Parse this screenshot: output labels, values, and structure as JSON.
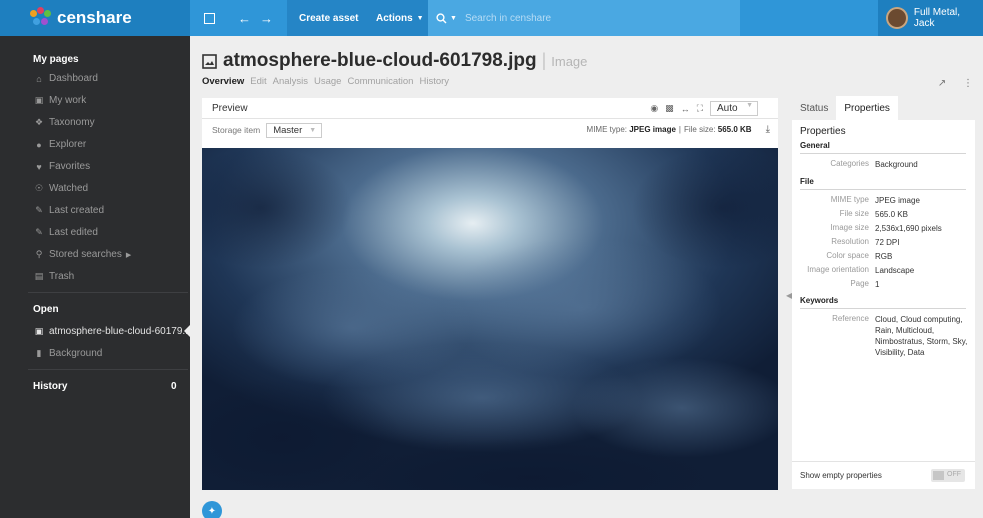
{
  "app": {
    "brand": "censhare",
    "create_asset": "Create asset",
    "actions": "Actions",
    "search_placeholder": "Search in censhare",
    "user_name": "Full Metal, Jack"
  },
  "sidebar": {
    "my_pages_title": "My pages",
    "items": [
      {
        "label": "Dashboard",
        "icon": "home-icon"
      },
      {
        "label": "My work",
        "icon": "inbox-icon"
      },
      {
        "label": "Taxonomy",
        "icon": "tag-icon"
      },
      {
        "label": "Explorer",
        "icon": "compass-icon"
      },
      {
        "label": "Favorites",
        "icon": "heart-icon"
      },
      {
        "label": "Watched",
        "icon": "eye-icon"
      },
      {
        "label": "Last created",
        "icon": "edit-icon"
      },
      {
        "label": "Last edited",
        "icon": "edit-icon"
      },
      {
        "label": "Stored searches",
        "icon": "search-icon"
      },
      {
        "label": "Trash",
        "icon": "trash-icon"
      }
    ],
    "open_title": "Open",
    "open_items": [
      {
        "label": "atmosphere-blue-cloud-60179...",
        "icon": "image-icon"
      },
      {
        "label": "Background",
        "icon": "folder-icon"
      }
    ],
    "history_title": "History",
    "history_count": "0"
  },
  "asset": {
    "filename": "atmosphere-blue-cloud-601798.jpg",
    "type": "Image",
    "tabs": [
      "Overview",
      "Edit",
      "Analysis",
      "Usage",
      "Communication",
      "History"
    ],
    "active_tab": "Overview"
  },
  "preview": {
    "title": "Preview",
    "zoom_value": "Auto",
    "storage_label": "Storage item",
    "storage_value": "Master",
    "mime_label": "MIME type:",
    "mime_value": "JPEG image",
    "filesize_label": "File size:",
    "filesize_value": "565.0 KB"
  },
  "properties_panel": {
    "tabs": [
      "Status",
      "Properties"
    ],
    "active_tab": "Properties",
    "heading": "Properties",
    "general_title": "General",
    "categories_key": "Categories",
    "categories_val": "Background",
    "file_title": "File",
    "file_rows": [
      {
        "k": "MIME type",
        "v": "JPEG image"
      },
      {
        "k": "File size",
        "v": "565.0 KB"
      },
      {
        "k": "Image size",
        "v": "2,536x1,690 pixels"
      },
      {
        "k": "Resolution",
        "v": "72 DPI"
      },
      {
        "k": "Color space",
        "v": "RGB"
      },
      {
        "k": "Image orientation",
        "v": "Landscape"
      },
      {
        "k": "Page",
        "v": "1"
      }
    ],
    "keywords_title": "Keywords",
    "reference_key": "Reference",
    "reference_val": "Cloud, Cloud computing, Rain, Multicloud, Nimbostratus, Storm, Sky, Visibility, Data",
    "footer_label": "Show empty properties",
    "toggle_text": "OFF"
  }
}
